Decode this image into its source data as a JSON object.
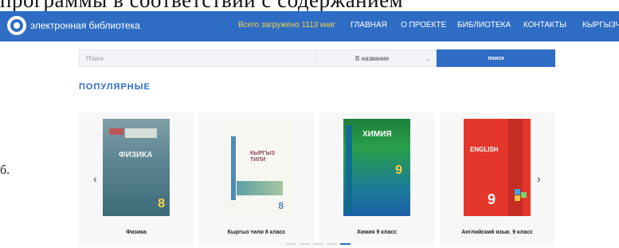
{
  "document_overlay": {
    "top_text": "программы в соответствии с содержанием",
    "left_char": "б."
  },
  "navbar": {
    "brand": "электронная библиотека",
    "total_books": "Всего загружено 1113 книг",
    "items": [
      {
        "label": "ГЛАВНАЯ"
      },
      {
        "label": "О ПРОЕКТЕ"
      },
      {
        "label": "БИБЛИОТЕКА"
      },
      {
        "label": "КОНТАКТЫ"
      },
      {
        "label": "КЫРГЫЗЧА"
      }
    ]
  },
  "search": {
    "placeholder": "Поиск",
    "select_value": "В названии",
    "button_label": "поиск"
  },
  "section": {
    "title": "ПОПУЛЯРНЫЕ"
  },
  "books": [
    {
      "title": "Физика",
      "cover_text": "ФИЗИКА",
      "grade": "8"
    },
    {
      "title": "Кыргыз тили 8 класс",
      "cover_text": "КЫРГЫЗ ТИЛИ",
      "grade": "8"
    },
    {
      "title": "Химия 9 класс",
      "cover_text": "ХИМИЯ",
      "grade": "9"
    },
    {
      "title": "Английский язык. 9 класс",
      "cover_text": "ENGLISH",
      "grade": "9"
    }
  ],
  "carousel": {
    "prev_icon": "‹",
    "next_icon": "›",
    "pages": 5,
    "active_page": 5
  },
  "colors": {
    "primary": "#2f6dc5",
    "accent_yellow": "#f3d34a"
  }
}
